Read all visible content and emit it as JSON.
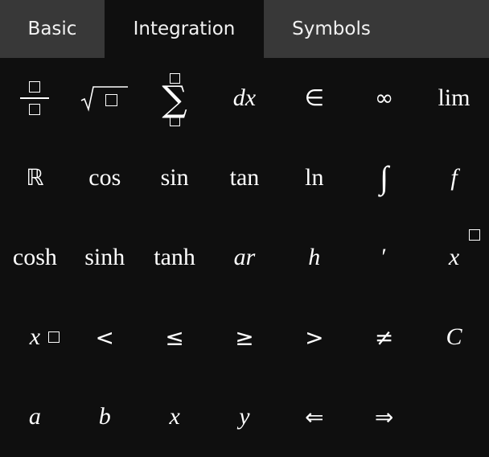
{
  "tabs": [
    {
      "label": "Basic",
      "active": false
    },
    {
      "label": "Integration",
      "active": true
    },
    {
      "label": "Symbols",
      "active": false
    }
  ],
  "keys": {
    "fraction": {
      "icon": "fraction-template-icon"
    },
    "sqrt": {
      "icon": "square-root-template-icon"
    },
    "sum": {
      "icon": "summation-template-icon"
    },
    "dx": "dx",
    "element_of": "∈",
    "infinity": "∞",
    "lim": "lim",
    "reals": "ℝ",
    "cos": "cos",
    "sin": "sin",
    "tan": "tan",
    "ln": "ln",
    "integral": "∫",
    "f": "f",
    "cosh": "cosh",
    "sinh": "sinh",
    "tanh": "tanh",
    "ar": "ar",
    "h": "h",
    "prime": "′",
    "x_sup": "x",
    "x_sub": "x",
    "less": "<",
    "leq": "≤",
    "geq": "≥",
    "greater": ">",
    "neq": "≠",
    "C": "C",
    "a": "a",
    "b": "b",
    "x": "x",
    "y": "y",
    "left_double_arrow": "⇐",
    "right_double_arrow": "⇒"
  }
}
